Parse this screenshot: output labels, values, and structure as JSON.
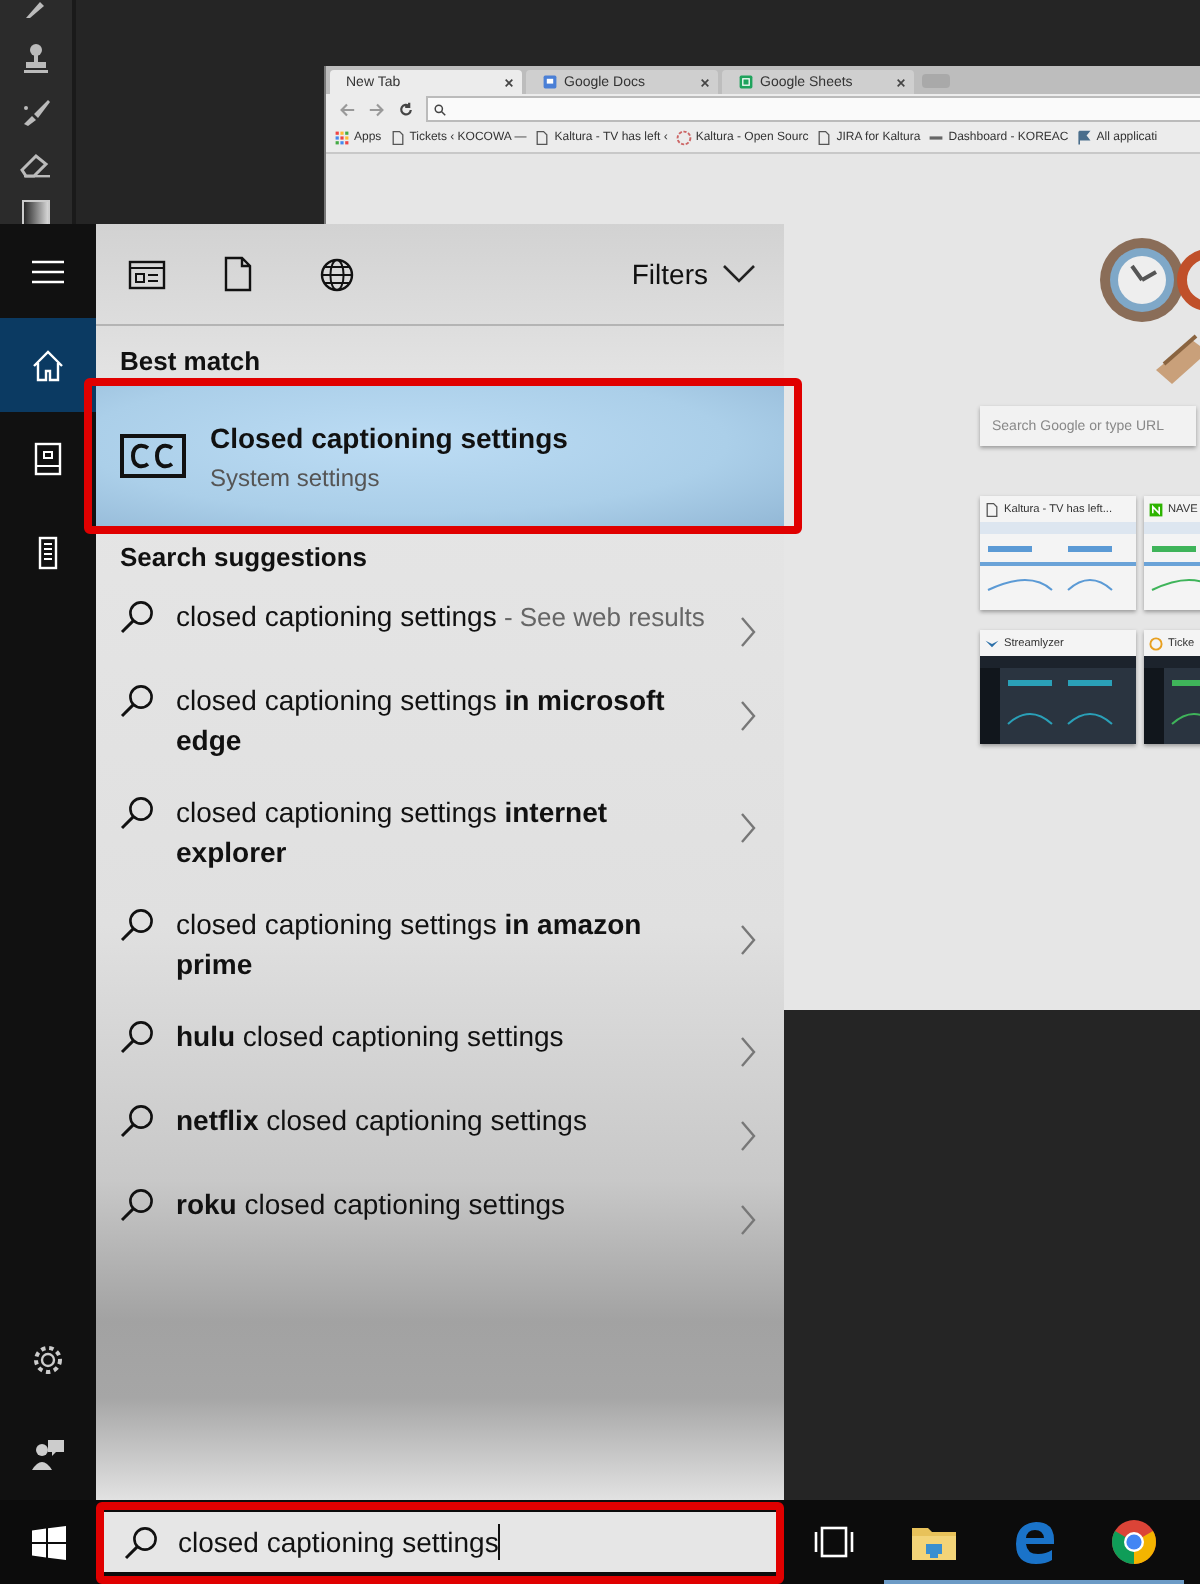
{
  "browser": {
    "tabs": [
      {
        "title": "New Tab",
        "selected": true,
        "kind": "page"
      },
      {
        "title": "Google Docs",
        "selected": false,
        "kind": "docs"
      },
      {
        "title": "Google Sheets",
        "selected": false,
        "kind": "sheets"
      }
    ],
    "bookmarks": [
      {
        "title": "Apps",
        "kind": "apps"
      },
      {
        "title": "Tickets ‹ KOCOWA —",
        "kind": "page"
      },
      {
        "title": "Kaltura - TV has left ‹",
        "kind": "page"
      },
      {
        "title": "Kaltura - Open Sourc",
        "kind": "star"
      },
      {
        "title": "JIRA for Kaltura",
        "kind": "page"
      },
      {
        "title": "Dashboard - KOREAC",
        "kind": "dash"
      },
      {
        "title": "All applicati",
        "kind": "flag"
      }
    ],
    "search": {
      "placeholder": "Search Google or type URL"
    },
    "tiles": [
      {
        "title": "Kaltura - TV has left...",
        "kind": "page"
      },
      {
        "title": "NAVE",
        "kind": "naver"
      },
      {
        "title": "Streamlyzer",
        "kind": "bird"
      },
      {
        "title": "Ticke",
        "kind": "ring"
      }
    ]
  },
  "sidebar": {
    "top": [
      {
        "kind": "menu",
        "selected": false
      },
      {
        "kind": "home",
        "selected": true
      },
      {
        "kind": "notebook",
        "selected": false
      },
      {
        "kind": "devices",
        "selected": false
      }
    ],
    "bottom": [
      {
        "kind": "settings",
        "selected": false
      },
      {
        "kind": "feedback",
        "selected": false
      }
    ]
  },
  "filters": {
    "scopes": [
      {
        "kind": "apps"
      },
      {
        "kind": "documents"
      },
      {
        "kind": "web"
      }
    ],
    "label": "Filters"
  },
  "best_match": {
    "heading": "Best match",
    "title": "Closed captioning settings",
    "subtitle": "System settings",
    "selected": true,
    "annotated": true
  },
  "suggestions": {
    "heading": "Search suggestions",
    "items": [
      {
        "text": "closed captioning settings",
        "note": " - See web results"
      },
      {
        "text": "closed captioning settings **in microsoft edge**"
      },
      {
        "text": "closed captioning settings **internet explorer**"
      },
      {
        "text": "closed captioning settings **in amazon prime**"
      },
      {
        "text": "**hulu** closed captioning settings"
      },
      {
        "text": "**netflix** closed captioning settings"
      },
      {
        "text": "**roku** closed captioning settings"
      }
    ]
  },
  "search_box": {
    "value": "closed captioning settings",
    "annotated": true
  },
  "taskbar": {
    "apps": [
      {
        "kind": "taskview",
        "running": false
      },
      {
        "kind": "explorer",
        "running": true
      },
      {
        "kind": "edge",
        "running": true
      },
      {
        "kind": "chrome",
        "running": true
      }
    ]
  }
}
